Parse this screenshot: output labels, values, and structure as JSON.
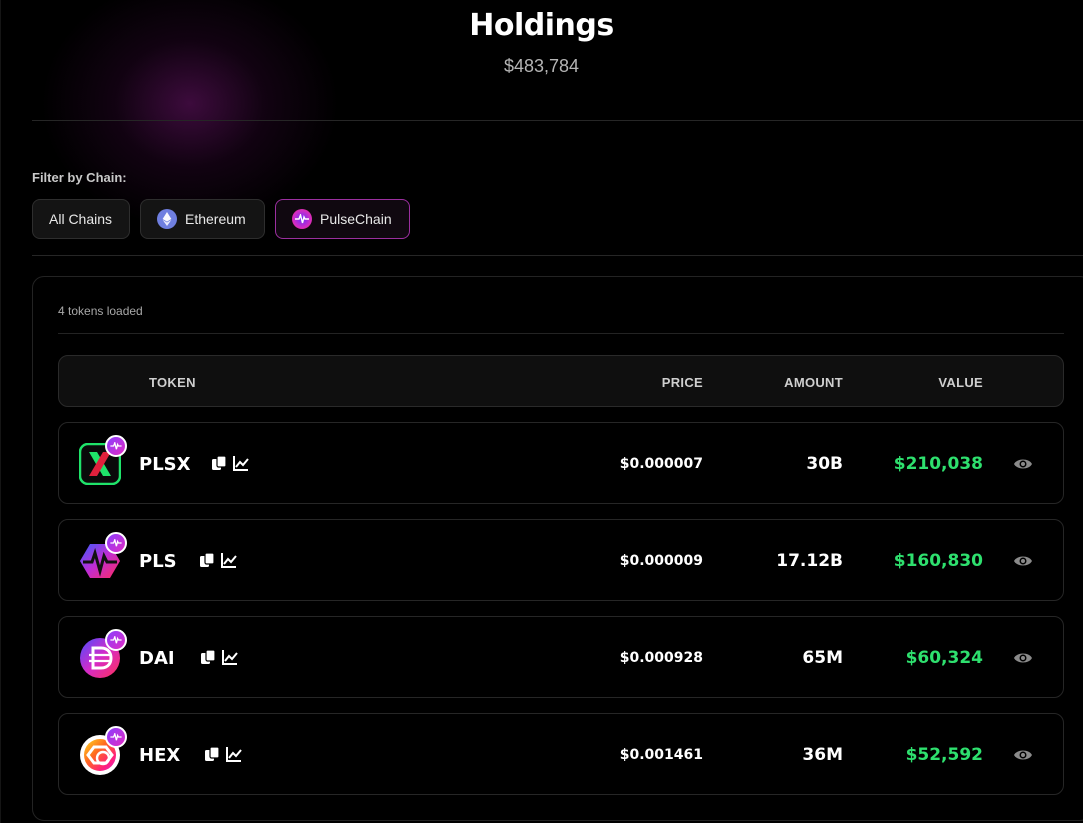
{
  "header": {
    "title": "Holdings",
    "total_value": "$483,784"
  },
  "filter": {
    "label": "Filter by Chain:",
    "chips": [
      {
        "label": "All Chains",
        "icon": "none",
        "active": false
      },
      {
        "label": "Ethereum",
        "icon": "ethereum-icon",
        "active": false
      },
      {
        "label": "PulseChain",
        "icon": "pulsechain-icon",
        "active": true
      }
    ]
  },
  "table": {
    "loaded_text": "4 tokens loaded",
    "columns": {
      "token": "TOKEN",
      "price": "PRICE",
      "amount": "AMOUNT",
      "value": "VALUE"
    },
    "rows": [
      {
        "symbol": "PLSX",
        "price": "$0.000007",
        "amount": "30B",
        "value": "$210,038",
        "logo": "plsx-logo"
      },
      {
        "symbol": "PLS",
        "price": "$0.000009",
        "amount": "17.12B",
        "value": "$160,830",
        "logo": "pls-logo"
      },
      {
        "symbol": "DAI",
        "price": "$0.000928",
        "amount": "65M",
        "value": "$60,324",
        "logo": "dai-logo"
      },
      {
        "symbol": "HEX",
        "price": "$0.001461",
        "amount": "36M",
        "value": "$52,592",
        "logo": "hex-logo"
      }
    ]
  },
  "colors": {
    "accent": "#9b2f9f",
    "value_green": "#2ee06e",
    "background": "#000000"
  }
}
